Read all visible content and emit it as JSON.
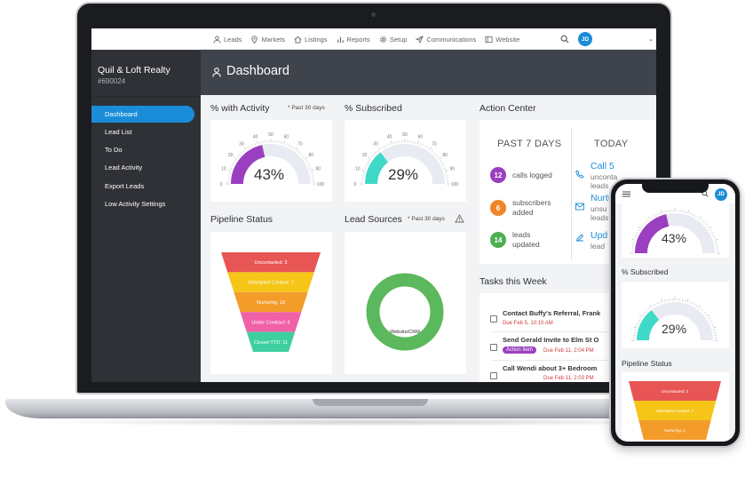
{
  "colors": {
    "accent": "#1a8cd8",
    "sidebar_bg": "#2f3136",
    "header_bg": "#3e434c",
    "activity_gauge": "#9a3fc0",
    "subscribed_gauge": "#3fd9c8",
    "circle_calls": "#9a3fc0",
    "circle_subscribers": "#f0862a",
    "circle_leads": "#4caf50",
    "lead_sources_ring": "#5cb85c"
  },
  "nav": {
    "items": [
      {
        "label": "Leads",
        "icon": "person-icon"
      },
      {
        "label": "Markets",
        "icon": "map-pin-icon"
      },
      {
        "label": "Listings",
        "icon": "home-icon"
      },
      {
        "label": "Reports",
        "icon": "bar-chart-icon"
      },
      {
        "label": "Setup",
        "icon": "gear-icon"
      },
      {
        "label": "Communications",
        "icon": "send-icon"
      },
      {
        "label": "Website",
        "icon": "browser-icon"
      }
    ],
    "avatar": "JD"
  },
  "sidebar": {
    "company": "Quil & Loft Realty",
    "account_id": "#690024",
    "items": [
      {
        "label": "Dashboard",
        "active": true
      },
      {
        "label": "Lead List"
      },
      {
        "label": "To Do"
      },
      {
        "label": "Lead Activity"
      },
      {
        "label": "Export Leads"
      },
      {
        "label": "Low Activity Settings"
      }
    ]
  },
  "header": {
    "title": "Dashboard"
  },
  "activity": {
    "title": "% with Activity",
    "note": "* Past 30 days",
    "value_label": "43%",
    "value": 43,
    "ticks": [
      "0",
      "10",
      "20",
      "30",
      "40",
      "50",
      "60",
      "70",
      "80",
      "90",
      "100"
    ]
  },
  "subscribed": {
    "title": "% Subscribed",
    "value_label": "29%",
    "value": 29,
    "ticks": [
      "0",
      "10",
      "20",
      "30",
      "40",
      "50",
      "60",
      "70",
      "80",
      "90",
      "100"
    ]
  },
  "pipeline": {
    "title": "Pipeline Status",
    "stages": [
      {
        "label": "Uncontacted: 3",
        "color": "#e85555"
      },
      {
        "label": "Attempted Contact: 7",
        "color": "#f5c518"
      },
      {
        "label": "Nurturing: 18",
        "color": "#f39c2a"
      },
      {
        "label": "Under Contract: 6",
        "color": "#f061a8"
      },
      {
        "label": "Closed YTD: 11",
        "color": "#3ecfa0"
      }
    ]
  },
  "lead_sources": {
    "title": "Lead Sources",
    "note": "* Past 30 days",
    "warning_icon": "warning-icon",
    "ring_label": "Website/CRM"
  },
  "action_center": {
    "title": "Action Center",
    "past_heading": "PAST 7 DAYS",
    "today_heading": "TODAY",
    "stats": [
      {
        "count": "12",
        "line1": "calls logged",
        "line2": ""
      },
      {
        "count": "6",
        "line1": "subscribers",
        "line2": "added"
      },
      {
        "count": "14",
        "line1": "leads",
        "line2": "updated"
      }
    ],
    "today": [
      {
        "link": "Call 5",
        "sub1": "unconta",
        "sub2": "leads",
        "icon": "phone-icon"
      },
      {
        "link": "Nurtur",
        "sub1": "unsu",
        "sub2": "leads",
        "icon": "mail-icon"
      },
      {
        "link": "Upd",
        "sub1": "lead",
        "sub2": "",
        "icon": "edit-icon"
      }
    ]
  },
  "tasks": {
    "title": "Tasks this Week",
    "items": [
      {
        "title": "Contact Buffy's Referral, Frank",
        "due": "Due Feb 5, 10:10 AM",
        "badge": ""
      },
      {
        "title": "Send Gerald Invite to Elm St O",
        "due": "Due Feb 11, 2:04 PM",
        "badge": "Action Item"
      },
      {
        "title": "Call Wendi about 3+ Bedroom",
        "due": "Due Feb 11, 2:03 PM",
        "badge": ""
      }
    ]
  },
  "phone": {
    "avatar": "JD",
    "activity_value_label": "43%",
    "subscribed_title": "% Subscribed",
    "subscribed_value_label": "29%",
    "pipeline_title": "Pipeline Status",
    "pipeline_stages": [
      "Uncontacted: 2",
      "Attempted Contact: 7",
      "Nurturing: 1"
    ]
  }
}
